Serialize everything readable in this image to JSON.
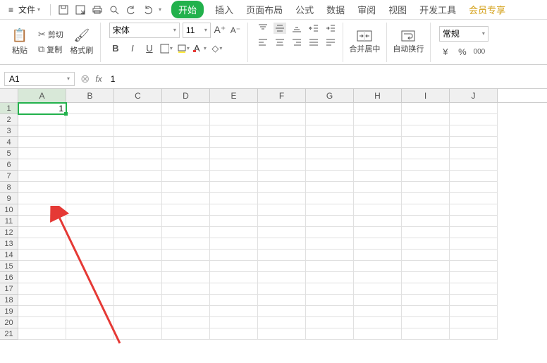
{
  "menu": {
    "file": "文件",
    "tabs": [
      "开始",
      "插入",
      "页面布局",
      "公式",
      "数据",
      "审阅",
      "视图",
      "开发工具",
      "会员专享"
    ]
  },
  "clipboard": {
    "paste": "粘贴",
    "cut": "剪切",
    "copy": "复制",
    "format_painter": "格式刷"
  },
  "font": {
    "name": "宋体",
    "size": "11"
  },
  "merge": {
    "label": "合并居中"
  },
  "wrap": {
    "label": "自动换行"
  },
  "number_format": {
    "label": "常规"
  },
  "namebox": {
    "value": "A1"
  },
  "formula": {
    "value": "1"
  },
  "columns": [
    "A",
    "B",
    "C",
    "D",
    "E",
    "F",
    "G",
    "H",
    "I",
    "J"
  ],
  "rows": [
    1,
    2,
    3,
    4,
    5,
    6,
    7,
    8,
    9,
    10,
    11,
    12,
    13,
    14,
    15,
    16,
    17,
    18,
    19,
    20,
    21
  ],
  "active_cell": {
    "row": 1,
    "col": "A",
    "value": "1"
  }
}
